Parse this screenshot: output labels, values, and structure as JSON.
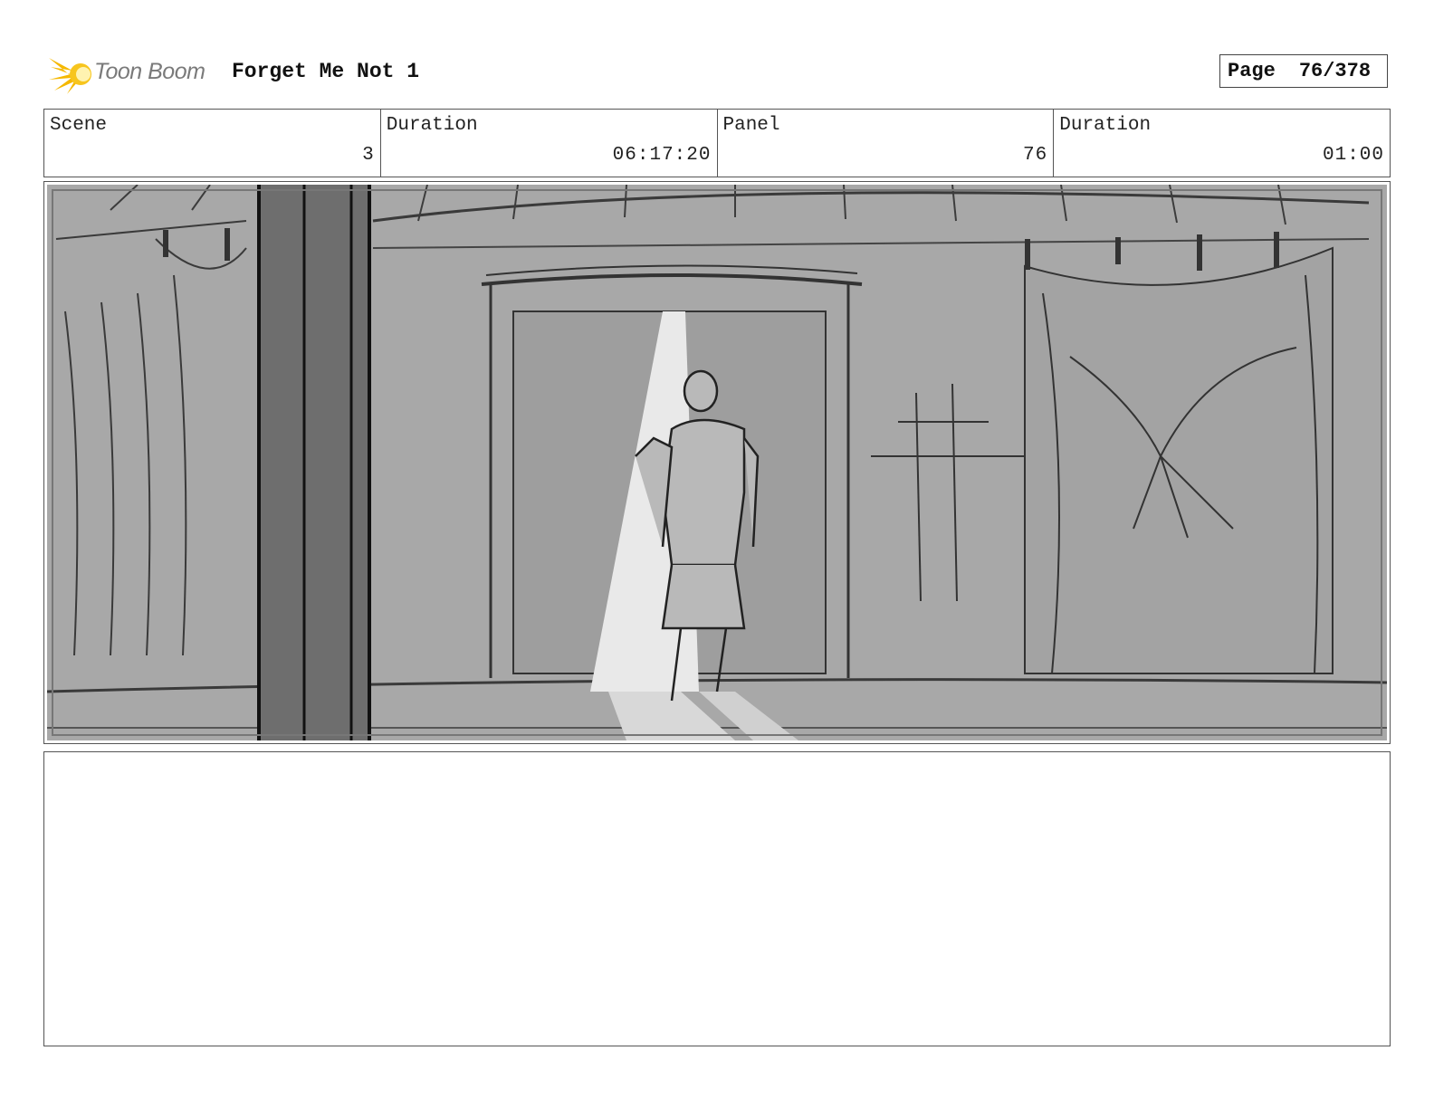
{
  "header": {
    "logo_text": "Toon Boom",
    "title": "Forget Me Not 1",
    "page_label": "Page",
    "page_number": "76/378"
  },
  "info": [
    {
      "label": "Scene",
      "value": "3"
    },
    {
      "label": "Duration",
      "value": "06:17:20"
    },
    {
      "label": "Panel",
      "value": "76"
    },
    {
      "label": "Duration",
      "value": "01:00"
    }
  ],
  "notes": ""
}
